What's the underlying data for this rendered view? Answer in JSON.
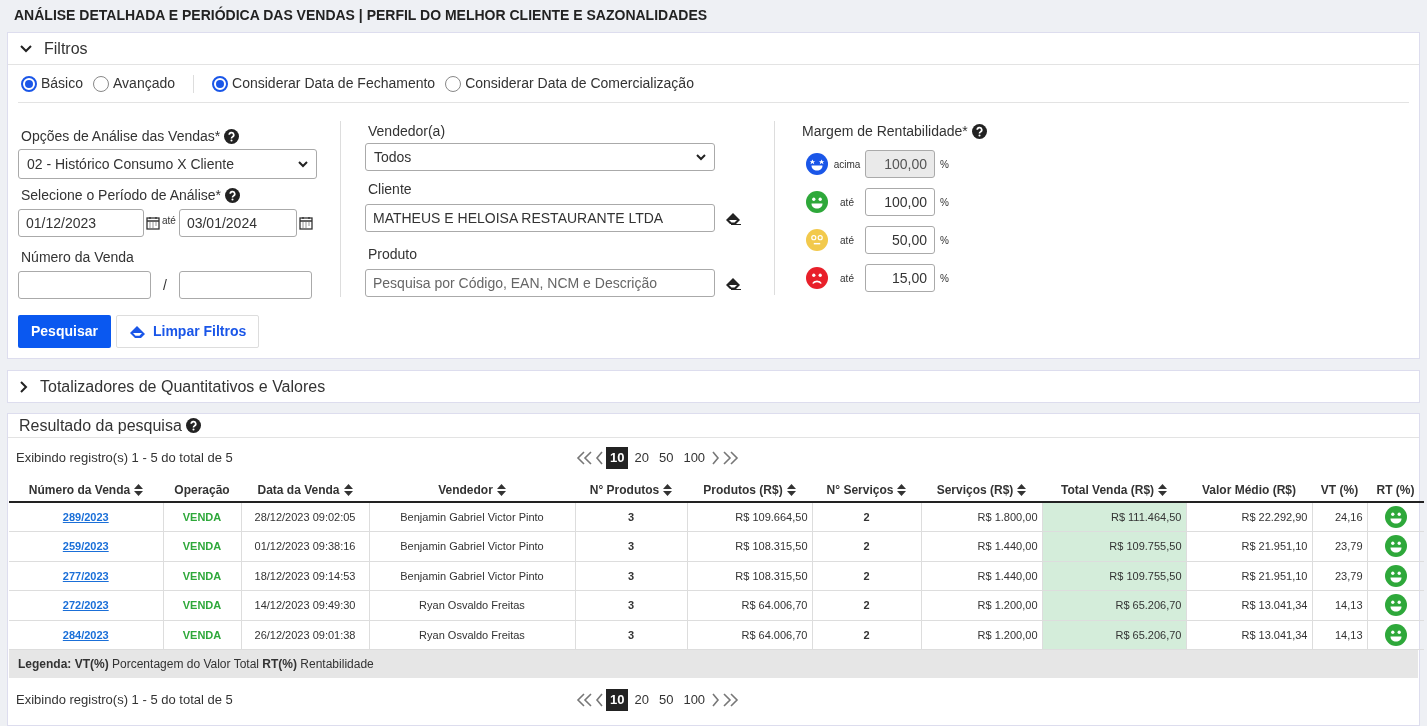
{
  "title": "ANÁLISE DETALHADA E PERIÓDICA DAS VENDAS | PERFIL DO MELHOR CLIENTE E SAZONALIDADES",
  "filters": {
    "title": "Filtros",
    "expanded": true,
    "mode_options": [
      {
        "label": "Básico",
        "selected": true
      },
      {
        "label": "Avançado",
        "selected": false
      }
    ],
    "date_options": [
      {
        "label": "Considerar Data de Fechamento",
        "selected": true
      },
      {
        "label": "Considerar Data de Comercialização",
        "selected": false
      }
    ],
    "analysis": {
      "label": "Opções de Análise das Vendas*",
      "value": "02 - Histórico Consumo X Cliente"
    },
    "period": {
      "label": "Selecione o Período de Análise*",
      "from": "01/12/2023",
      "separator": "até",
      "to": "03/01/2024"
    },
    "sale_number": {
      "label": "Número da Venda",
      "separator": "/"
    },
    "seller": {
      "label": "Vendedor(a)",
      "value": "Todos"
    },
    "client": {
      "label": "Cliente",
      "value": "MATHEUS E HELOISA RESTAURANTE LTDA"
    },
    "product": {
      "label": "Produto",
      "placeholder": "Pesquisa por Código, EAN, NCM e Descrição"
    },
    "margin": {
      "label": "Margem de Rentabilidade*",
      "rows": [
        {
          "kind": "excellent",
          "qualifier": "acima",
          "value": "100,00",
          "unit": "%",
          "disabled": true
        },
        {
          "kind": "good",
          "qualifier": "até",
          "value": "100,00",
          "unit": "%",
          "disabled": false
        },
        {
          "kind": "neutral",
          "qualifier": "até",
          "value": "50,00",
          "unit": "%",
          "disabled": false
        },
        {
          "kind": "bad",
          "qualifier": "até",
          "value": "15,00",
          "unit": "%",
          "disabled": false
        }
      ]
    },
    "search_button": "Pesquisar",
    "clear_button": "Limpar Filtros"
  },
  "totals": {
    "title": "Totalizadores de Quantitativos e Valores",
    "expanded": false
  },
  "results": {
    "title": "Resultado da pesquisa",
    "top_pager": {
      "summary": "Exibindo registro(s) 1 - 5 do total de 5",
      "page_sizes": [
        {
          "label": "10",
          "selected": true
        },
        {
          "label": "20",
          "selected": false
        },
        {
          "label": "50",
          "selected": false
        },
        {
          "label": "100",
          "selected": false
        }
      ]
    },
    "columns": [
      {
        "label": "Número da Venda",
        "sortable": true
      },
      {
        "label": "Operação",
        "sortable": false
      },
      {
        "label": "Data da Venda",
        "sortable": true
      },
      {
        "label": "Vendedor",
        "sortable": true
      },
      {
        "label": "N° Produtos",
        "sortable": true
      },
      {
        "label": "Produtos (R$)",
        "sortable": true
      },
      {
        "label": "N° Serviços",
        "sortable": true
      },
      {
        "label": "Serviços (R$)",
        "sortable": true
      },
      {
        "label": "Total Venda (R$)",
        "sortable": true
      },
      {
        "label": "Valor Médio (R$)",
        "sortable": false
      },
      {
        "label": "VT (%)",
        "sortable": false
      },
      {
        "label": "RT (%)",
        "sortable": false
      }
    ],
    "rows": [
      {
        "number": "289/2023",
        "operation": "VENDA",
        "date": "28/12/2023 09:02:05",
        "seller": "Benjamin Gabriel Victor Pinto",
        "n_products": "3",
        "products": "R$ 109.664,50",
        "n_services": "2",
        "services": "R$ 1.800,00",
        "total": "R$ 111.464,50",
        "average": "R$ 22.292,90",
        "vt": "24,16",
        "color": "#2ea83a"
      },
      {
        "number": "259/2023",
        "operation": "VENDA",
        "date": "01/12/2023 09:38:16",
        "seller": "Benjamin Gabriel Victor Pinto",
        "n_products": "3",
        "products": "R$ 108.315,50",
        "n_services": "2",
        "services": "R$ 1.440,00",
        "total": "R$ 109.755,50",
        "average": "R$ 21.951,10",
        "vt": "23,79",
        "color": "#2ea83a"
      },
      {
        "number": "277/2023",
        "operation": "VENDA",
        "date": "18/12/2023 09:14:53",
        "seller": "Benjamin Gabriel Victor Pinto",
        "n_products": "3",
        "products": "R$ 108.315,50",
        "n_services": "2",
        "services": "R$ 1.440,00",
        "total": "R$ 109.755,50",
        "average": "R$ 21.951,10",
        "vt": "23,79",
        "color": "#2ea83a"
      },
      {
        "number": "272/2023",
        "operation": "VENDA",
        "date": "14/12/2023 09:49:30",
        "seller": "Ryan Osvaldo Freitas",
        "n_products": "3",
        "products": "R$ 64.006,70",
        "n_services": "2",
        "services": "R$ 1.200,00",
        "total": "R$ 65.206,70",
        "average": "R$ 13.041,34",
        "vt": "14,13",
        "color": "#2ea83a"
      },
      {
        "number": "284/2023",
        "operation": "VENDA",
        "date": "26/12/2023 09:01:38",
        "seller": "Ryan Osvaldo Freitas",
        "n_products": "3",
        "products": "R$ 64.006,70",
        "n_services": "2",
        "services": "R$ 1.200,00",
        "total": "R$ 65.206,70",
        "average": "R$ 13.041,34",
        "vt": "14,13",
        "color": "#2ea83a"
      }
    ],
    "legend": "**Legenda:** **VT(%)** Porcentagem do Valor Total **RT(%)** Rentabilidade",
    "bottom_pager": {
      "summary": "Exibindo registro(s) 1 - 5 do total de 5",
      "page_sizes": [
        {
          "label": "10",
          "selected": true
        },
        {
          "label": "20",
          "selected": false
        },
        {
          "label": "50",
          "selected": false
        },
        {
          "label": "100",
          "selected": false
        }
      ]
    }
  }
}
